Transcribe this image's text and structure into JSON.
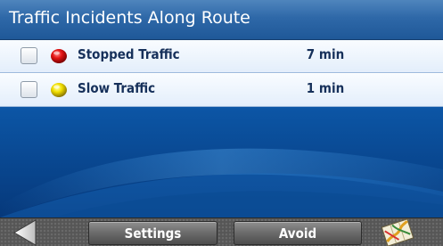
{
  "header": {
    "title": "Traffic Incidents Along Route"
  },
  "incidents": [
    {
      "label": "Stopped Traffic",
      "time": "7 min",
      "checked": false,
      "indicator_color": "#e01010",
      "icon": "red-dot-icon"
    },
    {
      "label": "Slow Traffic",
      "time": "1 min",
      "checked": false,
      "indicator_color": "#f0e000",
      "icon": "yellow-dot-icon"
    }
  ],
  "toolbar": {
    "back_icon": "back-arrow-icon",
    "settings_label": "Settings",
    "avoid_label": "Avoid",
    "map_icon": "map-icon"
  },
  "colors": {
    "title_bar": "#2e68a8",
    "row_background": "#eef5fd",
    "background": "#0a4d9a",
    "toolbar": "#565656"
  }
}
